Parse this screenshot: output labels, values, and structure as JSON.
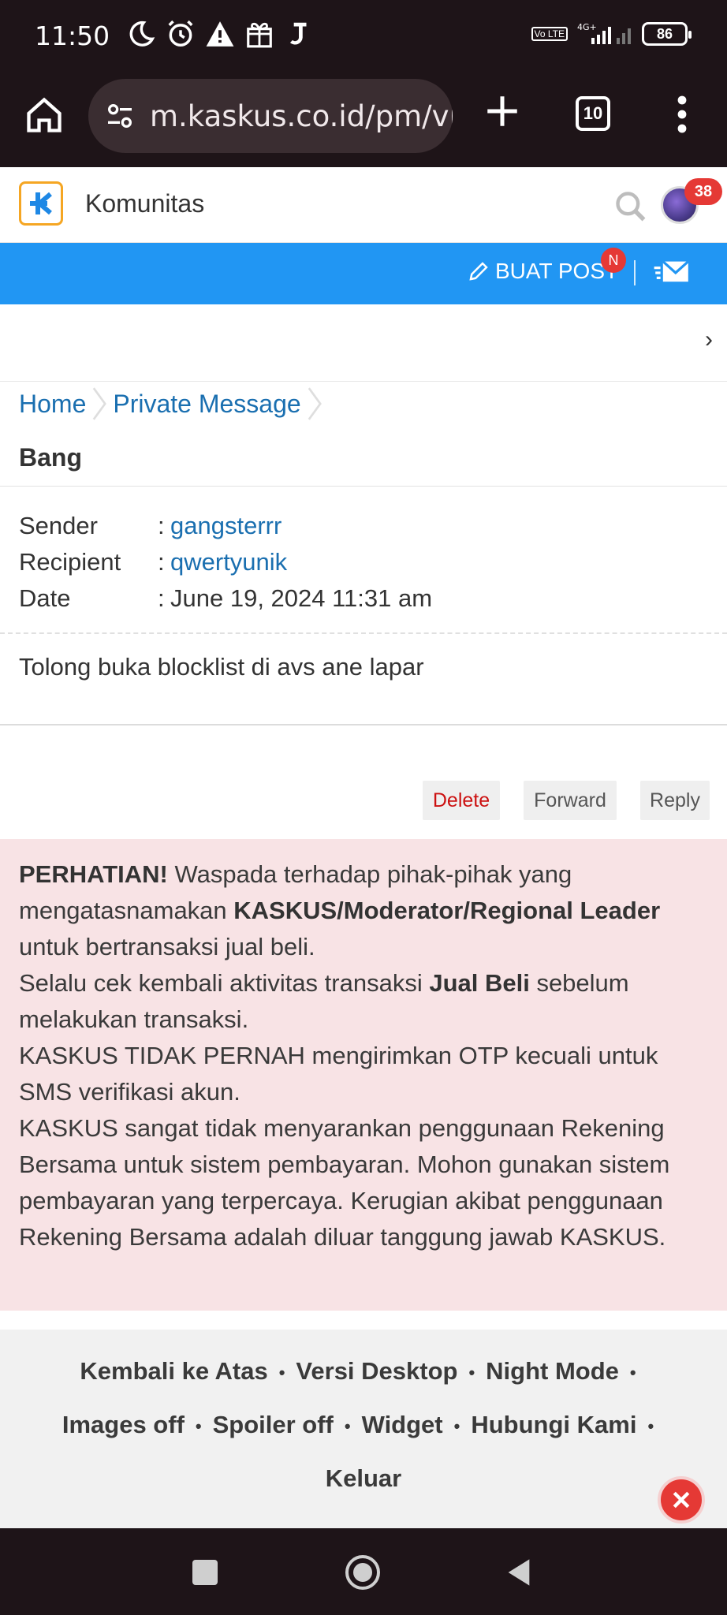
{
  "status_bar": {
    "time": "11:50",
    "lte": "Vo LTE",
    "network": "4G+",
    "battery": "86"
  },
  "browser": {
    "url": "m.kaskus.co.id/pm/vi",
    "tab_count": "10"
  },
  "site": {
    "brand": "Komunitas",
    "notification_count": "38",
    "create_post_label": "BUAT POST",
    "create_post_badge": "N"
  },
  "breadcrumb": [
    "Home",
    "Private Message"
  ],
  "message": {
    "subject": "Bang",
    "sender_label": "Sender",
    "sender": "gangsterrr",
    "recipient_label": "Recipient",
    "recipient": "qwertyunik",
    "date_label": "Date",
    "date": "June 19, 2024 11:31 am",
    "body": "Tolong buka blocklist di avs ane lapar"
  },
  "actions": {
    "delete": "Delete",
    "forward": "Forward",
    "reply": "Reply"
  },
  "warning": {
    "p1_bold": "PERHATIAN!",
    "p1_text": " Waspada terhadap pihak-pihak yang mengatasnamakan ",
    "p1_bold2": "KASKUS/Moderator/Regional Leader",
    "p1_text2": " untuk bertransaksi jual beli.",
    "p2_text": "Selalu cek kembali aktivitas transaksi ",
    "p2_bold": "Jual Beli",
    "p2_text2": " sebelum melakukan transaksi.",
    "p3": "KASKUS TIDAK PERNAH mengirimkan OTP kecuali untuk SMS verifikasi akun.",
    "p4": "KASKUS sangat tidak menyarankan penggunaan Rekening Bersama untuk sistem pembayaran. Mohon gunakan sistem pembayaran yang terpercaya. Kerugian akibat penggunaan Rekening Bersama adalah diluar tanggung jawab KASKUS."
  },
  "footer": {
    "links": [
      "Kembali ke Atas",
      "Versi Desktop",
      "Night Mode",
      "Images off",
      "Spoiler off",
      "Widget",
      "Hubungi Kami",
      "Keluar"
    ],
    "separator": "•"
  },
  "colors": {
    "accent_blue": "#2196f3",
    "link_blue": "#1a6fb0",
    "warning_bg": "#f8e3e5",
    "badge_red": "#e53935",
    "chrome_dark": "#1e1418"
  }
}
